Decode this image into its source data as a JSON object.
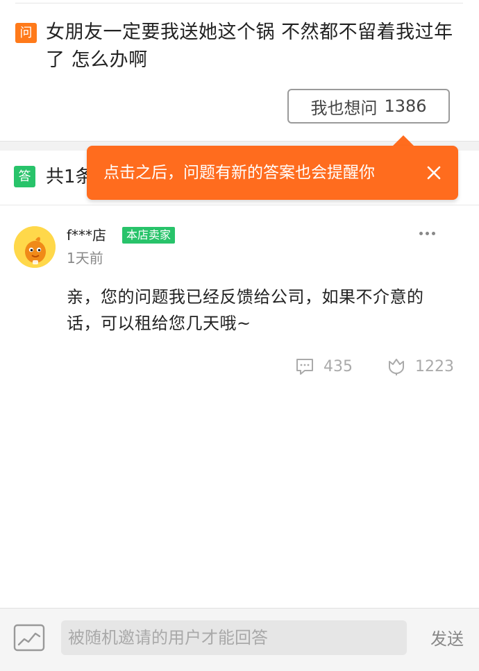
{
  "question": {
    "badge": "问",
    "text": "女朋友一定要我送她这个锅 不然都不留着我过年了 怎么办啊",
    "ask_too_label": "我也想问",
    "ask_too_count": "1386"
  },
  "answers_header": {
    "badge": "答",
    "count_text": "共1条"
  },
  "tooltip": {
    "text": "点击之后，问题有新的答案也会提醒你",
    "close_icon": "close-icon"
  },
  "answer": {
    "username": "f***店",
    "seller_tag": "本店卖家",
    "time": "1天前",
    "text": "亲，您的问题我已经反馈给公司，如果不介意的话，可以租给您几天哦~",
    "comments": "435",
    "likes": "1223",
    "icons": [
      "more-icon",
      "comment-icon",
      "like-icon"
    ]
  },
  "reply_bar": {
    "placeholder": "被随机邀请的用户才能回答",
    "send_label": "发送",
    "chart_icon": "chart-icon"
  },
  "colors": {
    "question_badge": "#ff7a1a",
    "answer_badge": "#28c36a",
    "tooltip_bg": "#ff6c1e",
    "seller_tag": "#28c36a"
  }
}
